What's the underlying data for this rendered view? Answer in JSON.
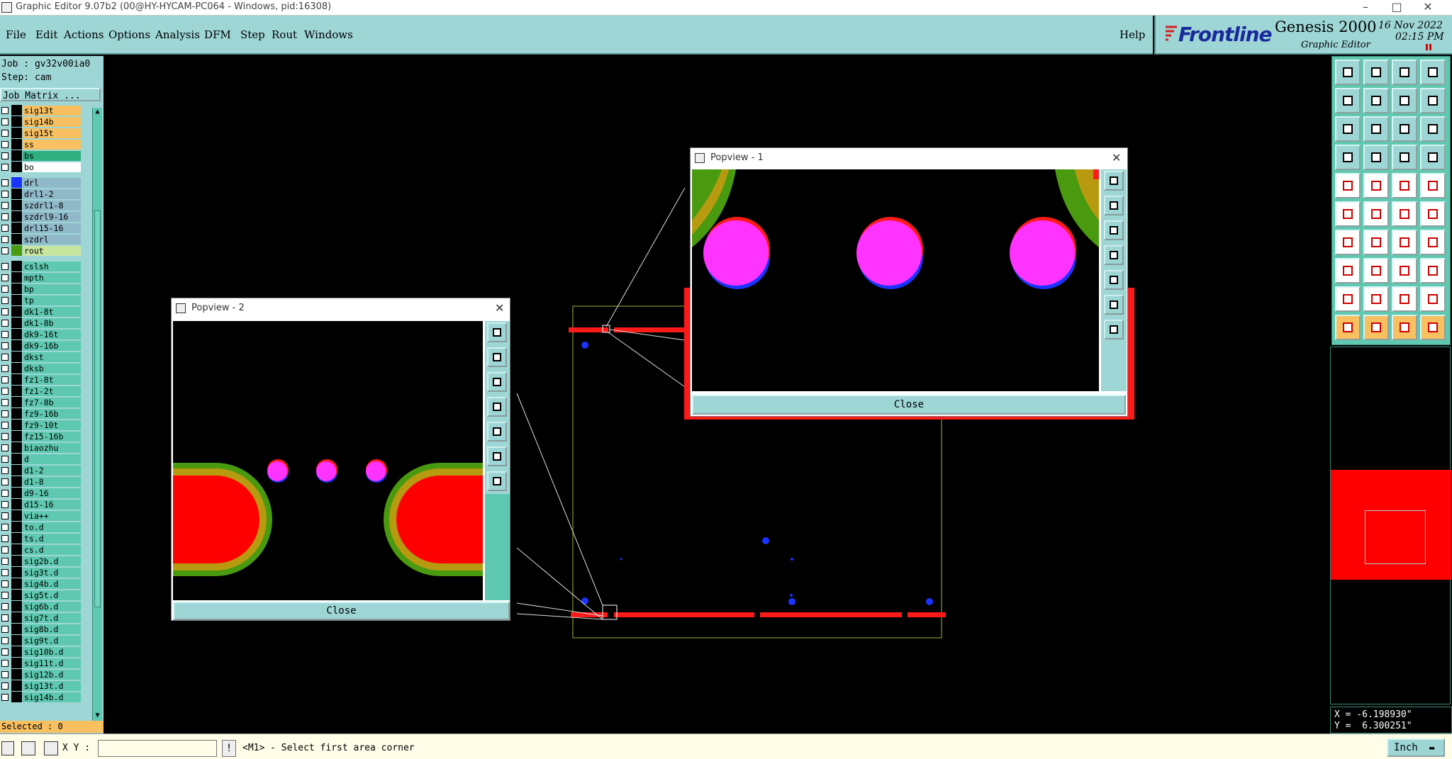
{
  "window": {
    "title": "Graphic Editor 9.07b2 (00@HY-HYCAM-PC064 - Windows, pid:16308)"
  },
  "menu": [
    "File",
    "Edit",
    "Actions",
    "Options",
    "Analysis",
    "DFM",
    "Step",
    "Rout",
    "Windows"
  ],
  "help_label": "Help",
  "brand": {
    "logo": "Frontline",
    "product": "Genesis 2000",
    "subtitle": "Graphic Editor",
    "date": "16 Nov 2022",
    "time": "02:15 PM"
  },
  "job": {
    "job_line": "Job : gv32v00ia0",
    "step_line": "Step: cam",
    "matrix_button": "Job Matrix ..."
  },
  "layers": [
    {
      "name": "sig13t",
      "color": "#f8c060"
    },
    {
      "name": "sig14b",
      "color": "#f8c060"
    },
    {
      "name": "sig15t",
      "color": "#f8c060"
    },
    {
      "name": "ss",
      "color": "#f8c060"
    },
    {
      "name": "bs",
      "color": "#2fae80"
    },
    {
      "name": "bo",
      "color": "#ffffff"
    },
    {
      "name": "drl",
      "color": "#8fb8c8",
      "swatch": "#1a33ff"
    },
    {
      "name": "drl1-2",
      "color": "#8fb8c8"
    },
    {
      "name": "szdrl1-8",
      "color": "#8fb8c8"
    },
    {
      "name": "szdrl9-16",
      "color": "#8fb8c8"
    },
    {
      "name": "drl15-16",
      "color": "#8fb8c8"
    },
    {
      "name": "szdrl",
      "color": "#8fb8c8"
    },
    {
      "name": "rout",
      "color": "#c8e6a0",
      "swatch": "#4a9a10"
    },
    {
      "name": "cslsh",
      "color": "#5ec9b0"
    },
    {
      "name": "mpth",
      "color": "#5ec9b0"
    },
    {
      "name": "bp",
      "color": "#5ec9b0"
    },
    {
      "name": "tp",
      "color": "#5ec9b0"
    },
    {
      "name": "dk1-8t",
      "color": "#5ec9b0"
    },
    {
      "name": "dk1-8b",
      "color": "#5ec9b0"
    },
    {
      "name": "dk9-16t",
      "color": "#5ec9b0"
    },
    {
      "name": "dk9-16b",
      "color": "#5ec9b0"
    },
    {
      "name": "dkst",
      "color": "#5ec9b0"
    },
    {
      "name": "dksb",
      "color": "#5ec9b0"
    },
    {
      "name": "fz1-8t",
      "color": "#5ec9b0"
    },
    {
      "name": "fz1-2t",
      "color": "#5ec9b0"
    },
    {
      "name": "fz7-8b",
      "color": "#5ec9b0"
    },
    {
      "name": "fz9-16b",
      "color": "#5ec9b0"
    },
    {
      "name": "fz9-10t",
      "color": "#5ec9b0"
    },
    {
      "name": "fz15-16b",
      "color": "#5ec9b0"
    },
    {
      "name": "biaozhu",
      "color": "#5ec9b0"
    },
    {
      "name": "d",
      "color": "#5ec9b0"
    },
    {
      "name": "d1-2",
      "color": "#5ec9b0"
    },
    {
      "name": "d1-8",
      "color": "#5ec9b0"
    },
    {
      "name": "d9-16",
      "color": "#5ec9b0"
    },
    {
      "name": "d15-16",
      "color": "#5ec9b0"
    },
    {
      "name": "via++",
      "color": "#5ec9b0"
    },
    {
      "name": "to.d",
      "color": "#5ec9b0"
    },
    {
      "name": "ts.d",
      "color": "#5ec9b0"
    },
    {
      "name": "cs.d",
      "color": "#5ec9b0"
    },
    {
      "name": "sig2b.d",
      "color": "#5ec9b0"
    },
    {
      "name": "sig3t.d",
      "color": "#5ec9b0"
    },
    {
      "name": "sig4b.d",
      "color": "#5ec9b0"
    },
    {
      "name": "sig5t.d",
      "color": "#5ec9b0"
    },
    {
      "name": "sig6b.d",
      "color": "#5ec9b0"
    },
    {
      "name": "sig7t.d",
      "color": "#5ec9b0"
    },
    {
      "name": "sig8b.d",
      "color": "#5ec9b0"
    },
    {
      "name": "sig9t.d",
      "color": "#5ec9b0"
    },
    {
      "name": "sig10b.d",
      "color": "#5ec9b0"
    },
    {
      "name": "sig11t.d",
      "color": "#5ec9b0"
    },
    {
      "name": "sig12b.d",
      "color": "#5ec9b0"
    },
    {
      "name": "sig13t.d",
      "color": "#5ec9b0"
    },
    {
      "name": "sig14b.d",
      "color": "#5ec9b0"
    }
  ],
  "selected": "Selected : 0",
  "popview1": {
    "title": "Popview - 1",
    "close": "Close"
  },
  "popview2": {
    "title": "Popview - 2",
    "close": "Close"
  },
  "coords": {
    "x": "X = -6.198930\"",
    "y": "Y =  6.300251\""
  },
  "status": {
    "xy_label": "X Y :",
    "xy_value": "",
    "message": "<M1> - Select first area corner",
    "unit": "Inch"
  },
  "colors": {
    "panel": "#9ed6d6",
    "board_red": "#ff0000",
    "pad_magenta": "#ff33ff",
    "drill_blue": "#1a33ff",
    "rout_green": "#4a9a10"
  }
}
